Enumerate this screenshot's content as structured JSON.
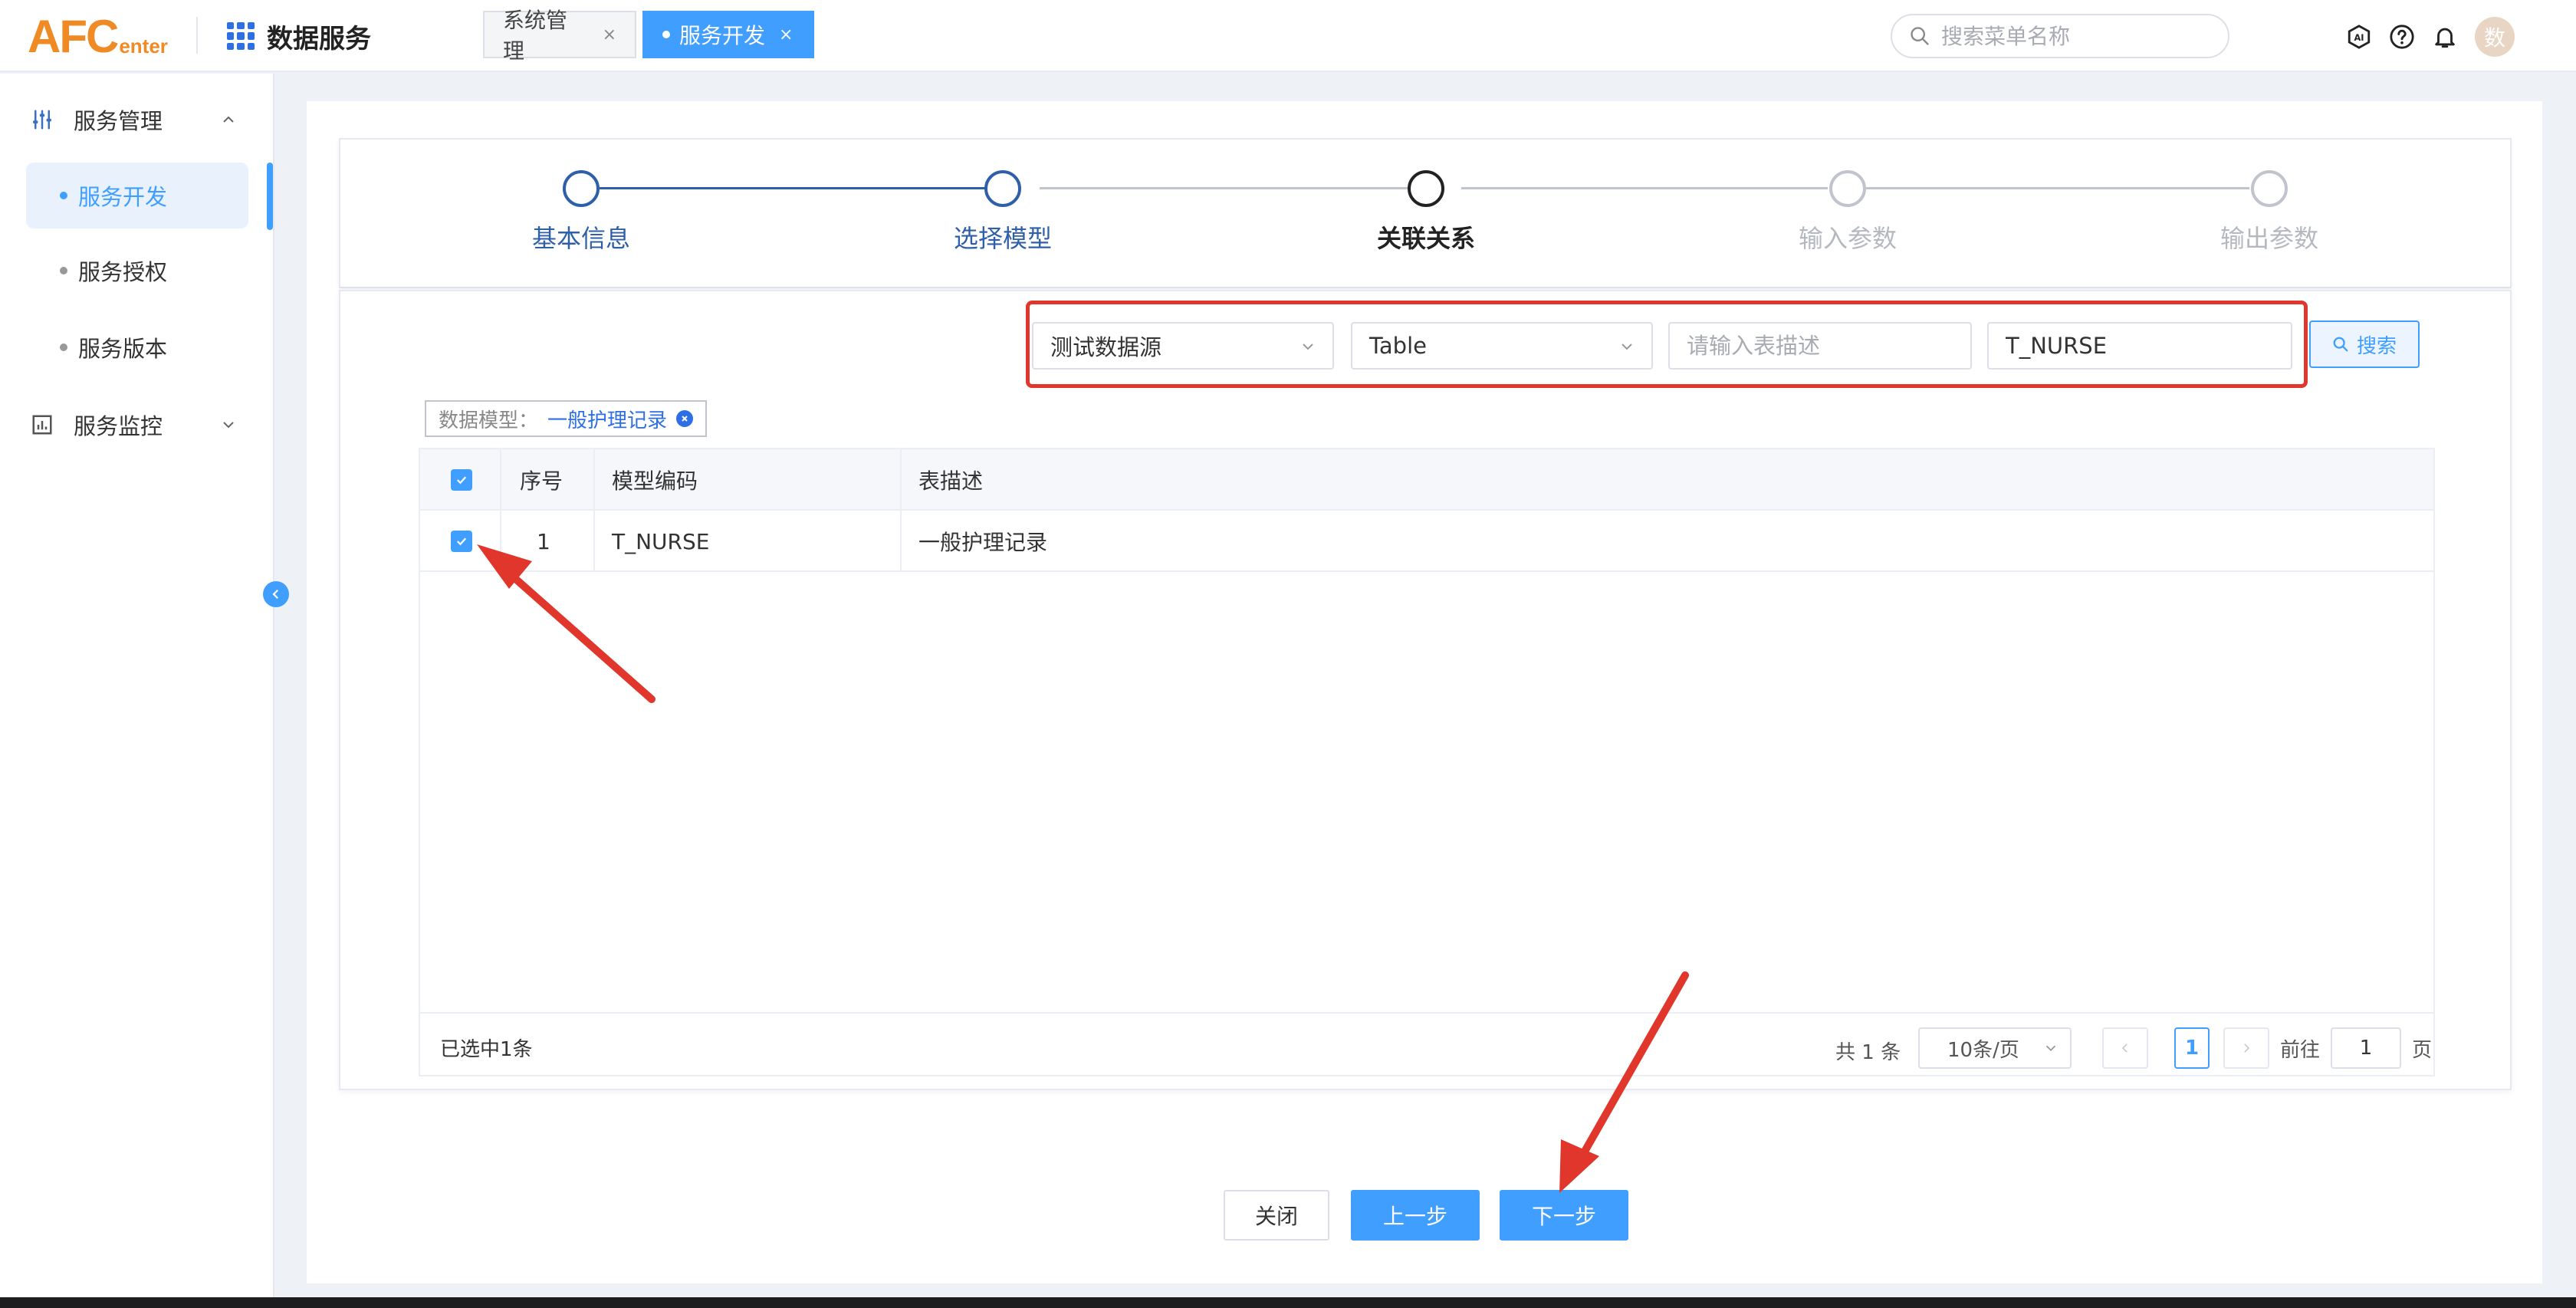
{
  "header": {
    "logo_big": "AFC",
    "logo_small": "enter",
    "app_title": "数据服务",
    "tabs": [
      {
        "label": "系统管理",
        "close": "×"
      },
      {
        "label": "服务开发",
        "close": "×"
      }
    ],
    "search_placeholder": "搜索菜单名称",
    "avatar": "数"
  },
  "sidebar": {
    "groups": [
      {
        "label": "服务管理",
        "icon": "sliders-icon",
        "expanded": true
      },
      {
        "label": "服务监控",
        "icon": "chart-icon",
        "expanded": false
      }
    ],
    "items": [
      {
        "label": "服务开发",
        "active": true
      },
      {
        "label": "服务授权",
        "active": false
      },
      {
        "label": "服务版本",
        "active": false
      }
    ]
  },
  "steps": [
    {
      "label": "基本信息",
      "state": "done"
    },
    {
      "label": "选择模型",
      "state": "done"
    },
    {
      "label": "关联关系",
      "state": "current"
    },
    {
      "label": "输入参数",
      "state": "pending"
    },
    {
      "label": "输出参数",
      "state": "pending"
    }
  ],
  "filters": {
    "datasource": "测试数据源",
    "type": "Table",
    "desc_placeholder": "请输入表描述",
    "table_name": "T_NURSE",
    "search_button": "搜索"
  },
  "selected_tag": {
    "key": "数据模型：",
    "value": "一般护理记录"
  },
  "table": {
    "columns": [
      "序号",
      "模型编码",
      "表描述"
    ],
    "rows": [
      {
        "index": "1",
        "code": "T_NURSE",
        "desc": "一般护理记录",
        "checked": true
      }
    ],
    "footer": {
      "selected": "已选中1条",
      "total": "共 1 条",
      "page_size": "10条/页",
      "current_page": "1",
      "goto_prefix": "前往",
      "goto_value": "1",
      "goto_suffix": "页"
    }
  },
  "actions": {
    "close": "关闭",
    "prev": "上一步",
    "next": "下一步"
  },
  "colors": {
    "primary": "#409eff",
    "step_done": "#2f5fa8",
    "annotation": "#e0362c",
    "logo": "#f08a24"
  }
}
